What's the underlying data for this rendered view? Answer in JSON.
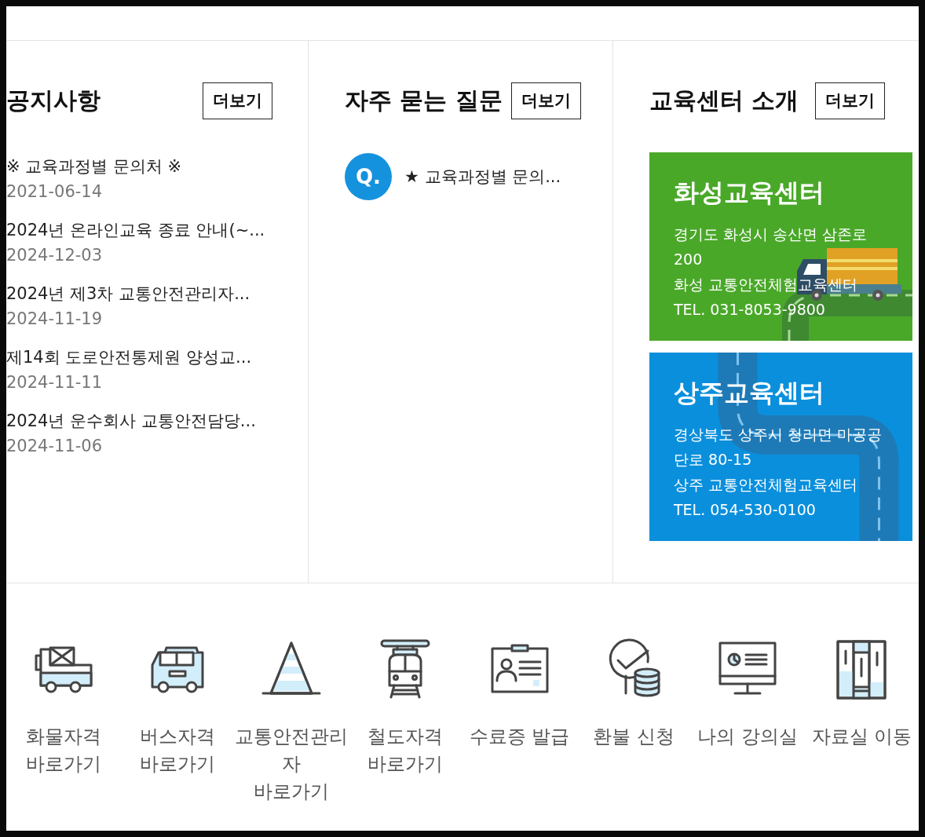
{
  "notices": {
    "title": "공지사항",
    "more": "더보기",
    "items": [
      {
        "title": "※ 교육과정별 문의처 ※",
        "date": "2021-06-14"
      },
      {
        "title": "2024년 온라인교육 종료 안내(~...",
        "date": "2024-12-03"
      },
      {
        "title": "2024년 제3차 교통안전관리자...",
        "date": "2024-11-19"
      },
      {
        "title": "제14회 도로안전통제원 양성교...",
        "date": "2024-11-11"
      },
      {
        "title": "2024년 운수회사 교통안전담당...",
        "date": "2024-11-06"
      }
    ]
  },
  "faq": {
    "title": "자주 묻는 질문",
    "more": "더보기",
    "items": [
      {
        "badge": "Q.",
        "question": "★ 교육과정별 문의..."
      }
    ]
  },
  "centers": {
    "title": "교육센터 소개",
    "more": "더보기",
    "cards": [
      {
        "name": "화성교육센터",
        "color": "#4aa829",
        "lines": [
          "경기도 화성시 송산면 삼존로",
          "200",
          "화성 교통안전체험교육센터",
          "TEL. 031-8053-9800"
        ]
      },
      {
        "name": "상주교육센터",
        "color": "#0a8fdc",
        "lines": [
          "경상북도 상주시 청리면 마공공",
          "단로 80-15",
          "상주 교통안전체험교육센터",
          "TEL. 054-530-0100"
        ]
      }
    ]
  },
  "quick_links": [
    {
      "lines": [
        "화물자격",
        "바로가기"
      ]
    },
    {
      "lines": [
        "버스자격",
        "바로가기"
      ]
    },
    {
      "lines": [
        "교통안전관리",
        "자",
        "바로가기"
      ]
    },
    {
      "lines": [
        "철도자격",
        "바로가기"
      ]
    },
    {
      "lines": [
        "수료증 발급"
      ]
    },
    {
      "lines": [
        "환불 신청"
      ]
    },
    {
      "lines": [
        "나의 강의실"
      ]
    },
    {
      "lines": [
        "자료실 이동"
      ]
    }
  ]
}
